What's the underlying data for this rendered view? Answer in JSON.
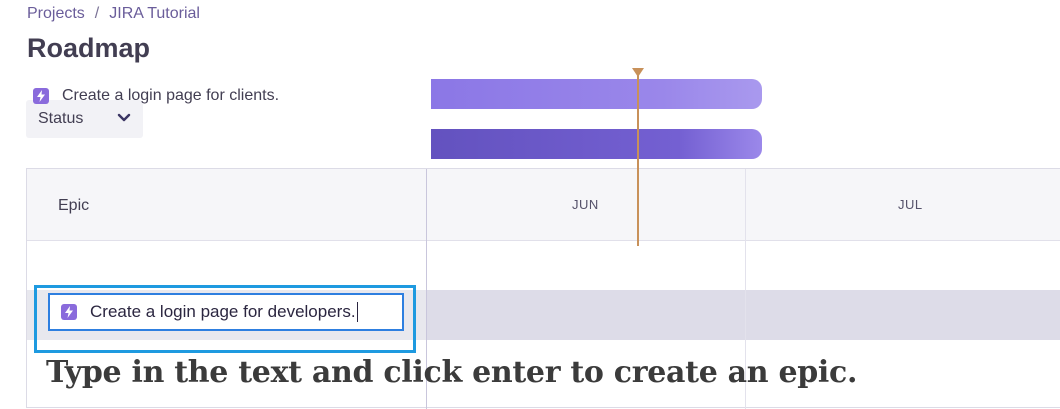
{
  "breadcrumb": {
    "items": [
      "Projects",
      "JIRA Tutorial"
    ],
    "separator": "/"
  },
  "page": {
    "title": "Roadmap"
  },
  "filters": {
    "status_label": "Status"
  },
  "roadmap": {
    "epic_column_header": "Epic",
    "months": [
      "JUN",
      "JUL"
    ],
    "epics": [
      {
        "label": "Create a login page for clients."
      }
    ],
    "new_epic_input": {
      "value": "Create a login page for developers."
    }
  },
  "caption": "Type in the text and click enter to create an epic.",
  "colors": {
    "accent": "#8a6bdc",
    "today_marker": "#c8915a",
    "highlight": "#1e9ae0"
  },
  "icons": {
    "status_chevron": "chevron-down-icon",
    "epic": "lightning-icon"
  }
}
